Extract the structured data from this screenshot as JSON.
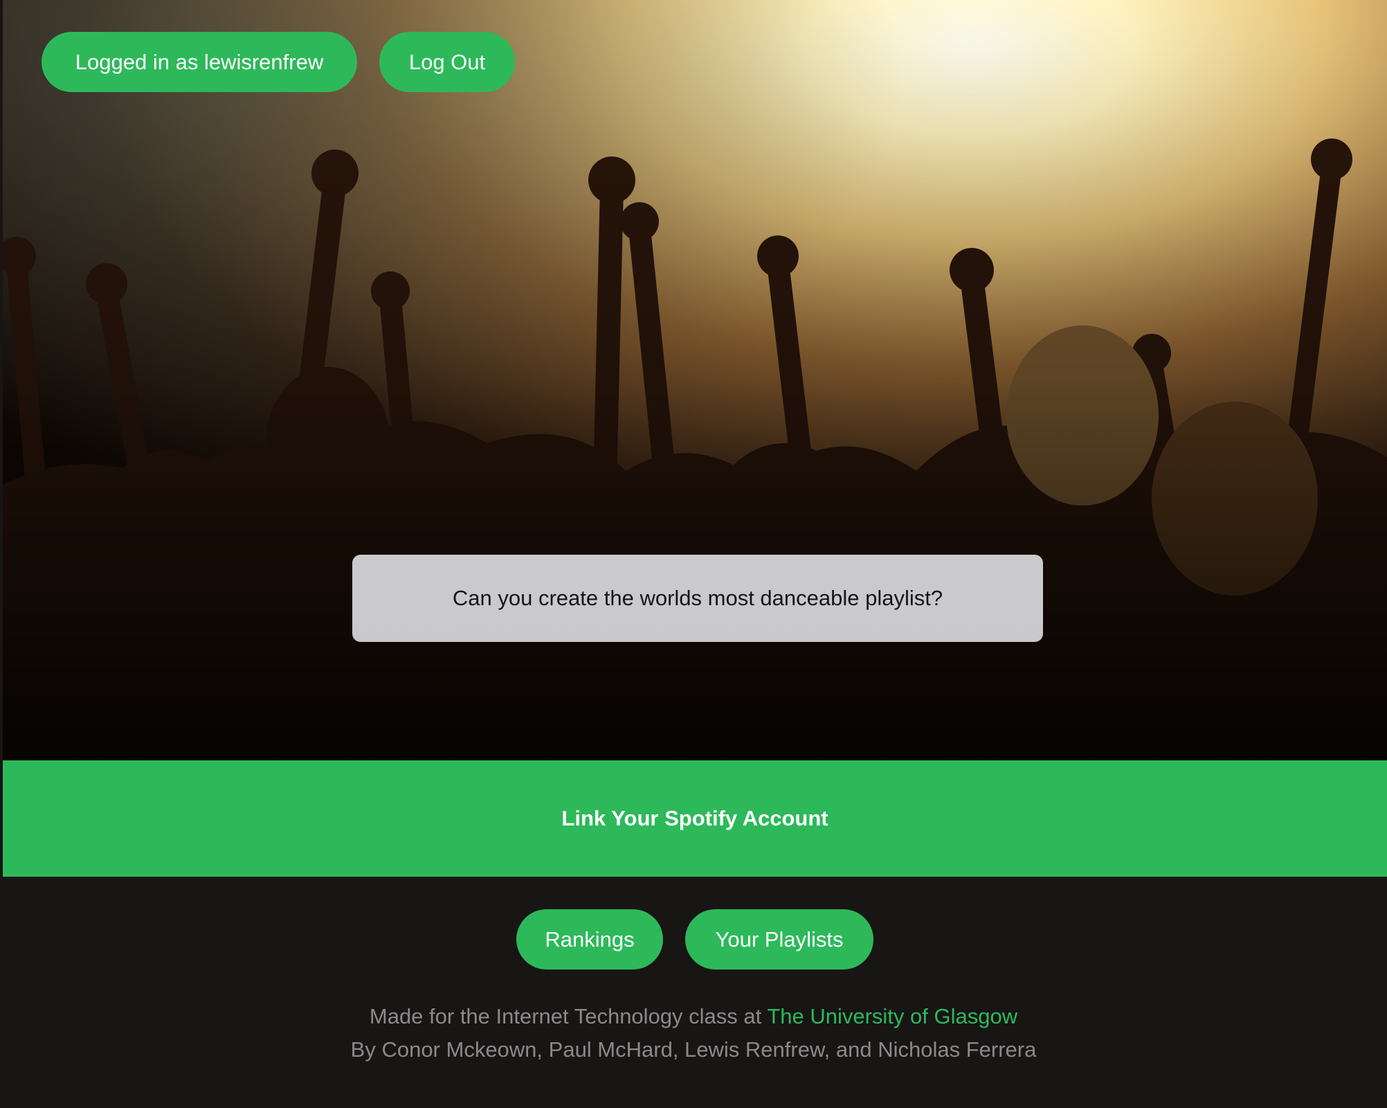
{
  "header": {
    "user_label": "Logged in as lewisrenfrew",
    "logout_label": "Log Out"
  },
  "hero": {
    "tagline": "Can you create the worlds most danceable playlist?"
  },
  "spotify": {
    "link_label": "Link Your Spotify Account"
  },
  "nav": {
    "rankings_label": "Rankings",
    "playlists_label": "Your Playlists"
  },
  "footer": {
    "made_for_prefix": "Made for the Internet Technology class at ",
    "university_link": "The University of Glasgow",
    "authors": "By Conor Mckeown, Paul McHard, Lewis Renfrew, and Nicholas Ferrera"
  },
  "colors": {
    "brand_green": "#2db95a",
    "footer_background": "#181515",
    "footer_text": "#8a8a8a",
    "tagline_box": "#e4e4e8"
  }
}
